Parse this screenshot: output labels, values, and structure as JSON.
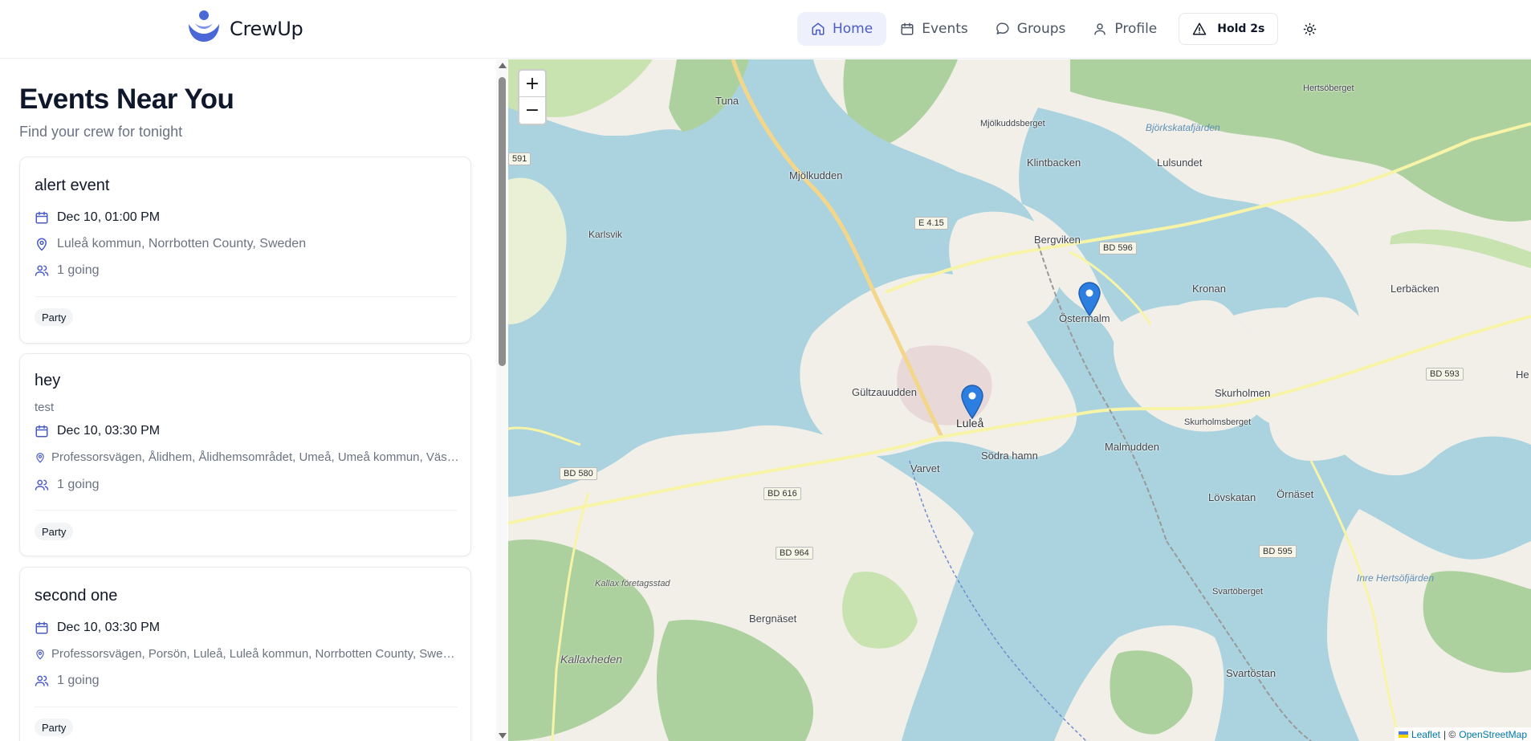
{
  "app": {
    "name": "CrewUp",
    "accent": "#4a5bc4"
  },
  "nav": {
    "items": [
      {
        "label": "Home",
        "icon": "home-icon",
        "active": true
      },
      {
        "label": "Events",
        "icon": "calendar-icon",
        "active": false
      },
      {
        "label": "Groups",
        "icon": "chat-bubble-icon",
        "active": false
      },
      {
        "label": "Profile",
        "icon": "user-icon",
        "active": false
      }
    ],
    "hold_button": "Hold 2s",
    "theme_toggle": "sun-icon"
  },
  "sidebar": {
    "title": "Events Near You",
    "subtitle": "Find your crew for tonight",
    "events": [
      {
        "title": "alert event",
        "description": "",
        "date": "Dec 10, 01:00 PM",
        "location": "Luleå kommun, Norrbotten County, Sweden",
        "going": "1 going",
        "tag": "Party"
      },
      {
        "title": "hey",
        "description": "test",
        "date": "Dec 10, 03:30 PM",
        "location": "Professorsvägen, Ålidhem, Ålidhemsområdet, Umeå, Umeå kommun, Västerbotten County, Sweden",
        "going": "1 going",
        "tag": "Party"
      },
      {
        "title": "second one",
        "description": "",
        "date": "Dec 10, 03:30 PM",
        "location": "Professorsvägen, Porsön, Luleå, Luleå kommun, Norrbotten County, Sweden",
        "going": "1 going",
        "tag": "Party"
      }
    ]
  },
  "map": {
    "zoom_in": "+",
    "zoom_out": "−",
    "attribution": {
      "leaflet": "Leaflet",
      "separator": "| ©",
      "osm": "OpenStreetMap"
    },
    "places": [
      "Tuna",
      "Mjölkuddsberget",
      "Björkskatafjärden",
      "Hertsöberget",
      "Mjölkudden",
      "Klintbacken",
      "Lulsundet",
      "Karlsvik",
      "Bergviken",
      "Kronan",
      "Lerbäcken",
      "Östermalm",
      "Gültzauudden",
      "Luleå",
      "Skurholmen",
      "Skurholmsberget",
      "Malmudden",
      "Södra hamn",
      "Varvet",
      "Lövskatan",
      "Örnäset",
      "Svartöberget",
      "Inre Hertsöfjärden",
      "Kallax företagsstad",
      "Bergnäset",
      "Kallaxheden",
      "Svartöstan",
      "He"
    ],
    "roads": [
      "591",
      "E 4.15",
      "BD 596",
      "BD 593",
      "BD 580",
      "BD 616",
      "BD 964",
      "BD 595"
    ]
  }
}
